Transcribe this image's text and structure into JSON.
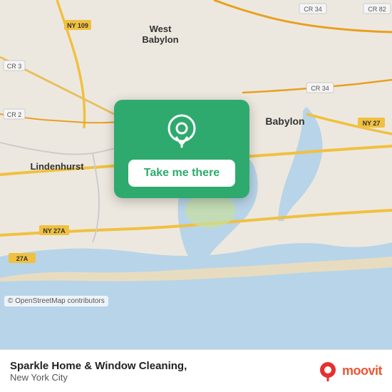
{
  "map": {
    "alt": "Map of Babylon, New York area",
    "osm_attribution": "© OpenStreetMap contributors"
  },
  "action_card": {
    "button_label": "Take me there",
    "pin_icon": "location-pin"
  },
  "bottom_bar": {
    "place_name": "Sparkle Home & Window Cleaning,",
    "city_name": "New York City",
    "moovit_label": "moovit"
  }
}
